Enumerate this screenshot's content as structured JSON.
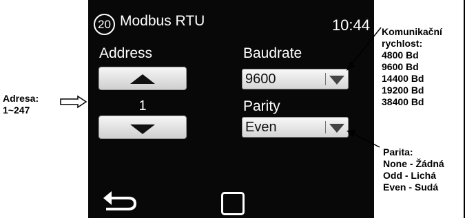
{
  "header": {
    "screen_number": "20",
    "title": "Modbus RTU",
    "time": "10:44"
  },
  "address": {
    "label": "Address",
    "value": "1"
  },
  "baudrate": {
    "label": "Baudrate",
    "selected": "9600"
  },
  "parity": {
    "label": "Parity",
    "selected": "Even"
  },
  "annotations": {
    "address": [
      "Adresa:",
      "1~247"
    ],
    "baudrate": [
      "Komunikační",
      "rychlost:",
      "4800 Bd",
      "9600 Bd",
      "14400 Bd",
      "19200 Bd",
      "38400 Bd"
    ],
    "parity": [
      "Parita:",
      "None - Žádná",
      "Odd - Lichá",
      "Even - Sudá"
    ]
  },
  "icons": {
    "back": "back-arrow-icon",
    "home": "home-square-icon"
  }
}
